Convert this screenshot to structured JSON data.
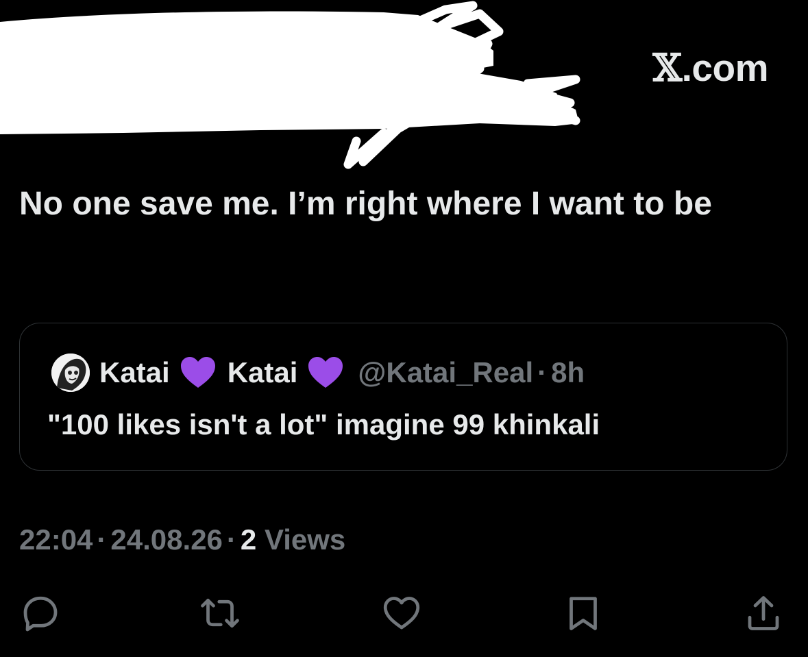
{
  "brand": {
    "mark": "𝕏",
    "domain": ".com"
  },
  "tweet": {
    "text": "No one save me. I’m right where I want to be"
  },
  "quote": {
    "display_name_1": "Katai",
    "display_name_2": "Katai",
    "handle": "@Katai_Real",
    "separator": "·",
    "time": "8h",
    "text": "\"100 likes isn't a lot\" imagine 99 khinkali",
    "emoji_icon": "purple-heart-icon",
    "emoji_color": "#9b4de8"
  },
  "meta": {
    "time": "22:04",
    "separator": "·",
    "date": "24.08.26",
    "views_count": "2",
    "views_label": "Views"
  },
  "actions": [
    {
      "name": "reply",
      "icon": "reply-icon"
    },
    {
      "name": "retweet",
      "icon": "retweet-icon"
    },
    {
      "name": "like",
      "icon": "heart-icon"
    },
    {
      "name": "bookmark",
      "icon": "bookmark-icon"
    },
    {
      "name": "share",
      "icon": "share-icon"
    }
  ],
  "colors": {
    "background": "#000000",
    "primary_text": "#e7e9ea",
    "secondary_text": "#71767b",
    "border": "#2f3336",
    "redaction": "#ffffff"
  }
}
